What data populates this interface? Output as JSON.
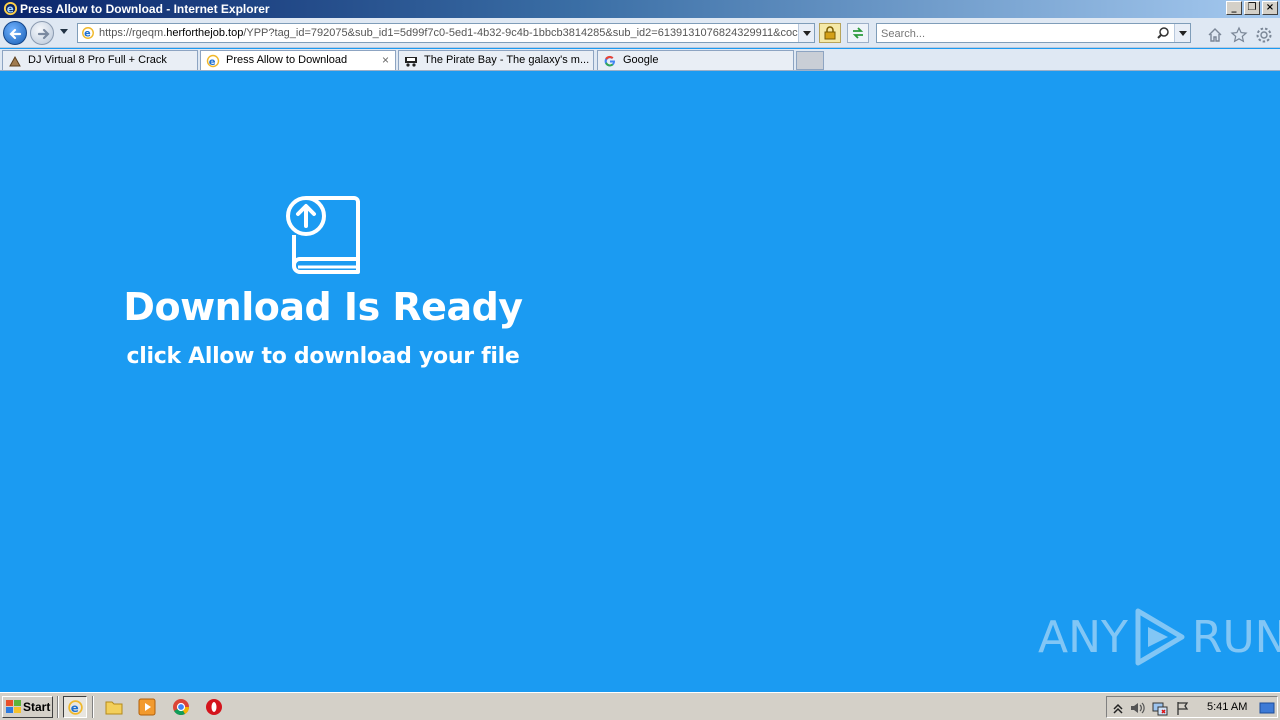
{
  "window": {
    "title": "Press Allow to Download - Internet Explorer",
    "controls": {
      "minimize": "_",
      "restore": "❐",
      "close": "×"
    }
  },
  "navbar": {
    "address": {
      "prefix": "https://rgeqm.",
      "domain": "herforthejob.top",
      "path": "/YPP?tag_id=792075&sub_id1=5d99f7c0-5ed1-4b32-9c4b-1bbcb3814285&sub_id2=6139131076824329911&coc"
    },
    "search": {
      "placeholder": "Search..."
    },
    "icons": [
      "back-icon",
      "forward-icon",
      "lock-icon",
      "refresh-icon",
      "search-icon",
      "home-icon",
      "favorites-star-icon",
      "settings-gear-icon"
    ]
  },
  "tabs": [
    {
      "label": "DJ Virtual 8 Pro Full + Crack",
      "icon": "page-icon",
      "active": false
    },
    {
      "label": "Press Allow to Download",
      "icon": "ie-icon",
      "active": true,
      "close": "×"
    },
    {
      "label": "The Pirate Bay - The galaxy's m...",
      "icon": "pirate-ship-icon",
      "active": false
    },
    {
      "label": "Google",
      "icon": "google-icon",
      "active": false
    }
  ],
  "content": {
    "title": "Download Is Ready",
    "subtitle": "click Allow to download your file",
    "icon": "upload-book-icon",
    "background": "#1b9bf2"
  },
  "watermark": {
    "text_left": "ANY",
    "text_right": "RUN"
  },
  "taskbar": {
    "start_label": "Start",
    "quick_launch": [
      "ie-icon",
      "folder-icon",
      "media-player-icon",
      "chrome-icon",
      "opera-icon"
    ],
    "tray_icons": [
      "show-hidden-icon",
      "volume-icon",
      "network-icon",
      "flag-icon",
      "desktop-icon"
    ],
    "clock": "5:41 AM"
  }
}
